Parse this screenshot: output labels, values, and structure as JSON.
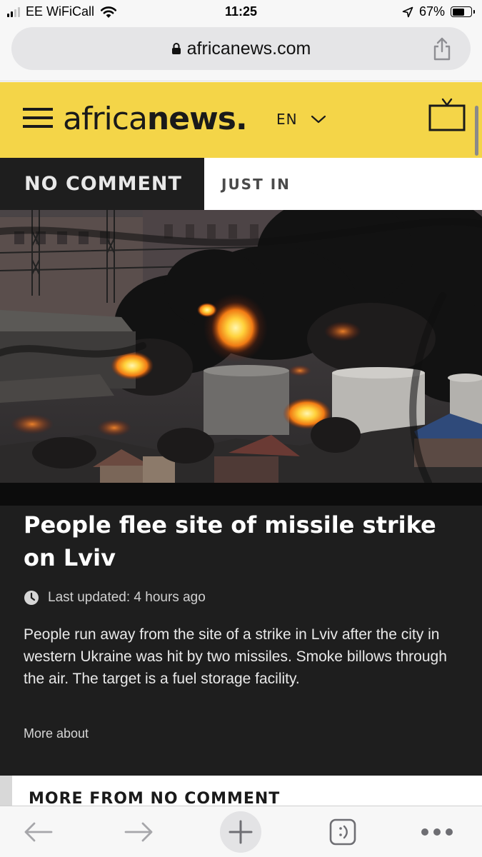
{
  "status_bar": {
    "carrier": "EE WiFiCall",
    "time": "11:25",
    "battery_percent": "67%",
    "battery_level": 0.67,
    "icons": [
      "signal-icon",
      "wifi-icon",
      "location-arrow-icon",
      "battery-icon"
    ]
  },
  "browser": {
    "url": "africanews.com",
    "icons": [
      "lock-icon",
      "share-icon",
      "back-arrow-icon",
      "forward-arrow-icon",
      "new-tab-icon",
      "tabs-icon",
      "more-icon"
    ]
  },
  "site": {
    "logo_light": "africa",
    "logo_bold": "news",
    "logo_dot": ".",
    "language": "EN",
    "brand_color": "#f4d548",
    "icons": [
      "hamburger-menu-icon",
      "chevron-down-icon",
      "tv-icon"
    ]
  },
  "tabs": {
    "active": "NO COMMENT",
    "inactive": "JUST IN"
  },
  "article": {
    "headline": "People flee site of missile strike on Lviv",
    "updated_label": "Last updated: 4 hours ago",
    "summary": "People run away from the site of a strike in Lviv after the city in western Ukraine was hit by two missiles. Smoke billows through the air. The target is a fuel storage facility.",
    "more_about": "More about",
    "image_icon": "video-still-fire-smoke",
    "clock_icon": "clock-icon"
  },
  "next_section": {
    "title": "MORE FROM NO COMMENT"
  }
}
